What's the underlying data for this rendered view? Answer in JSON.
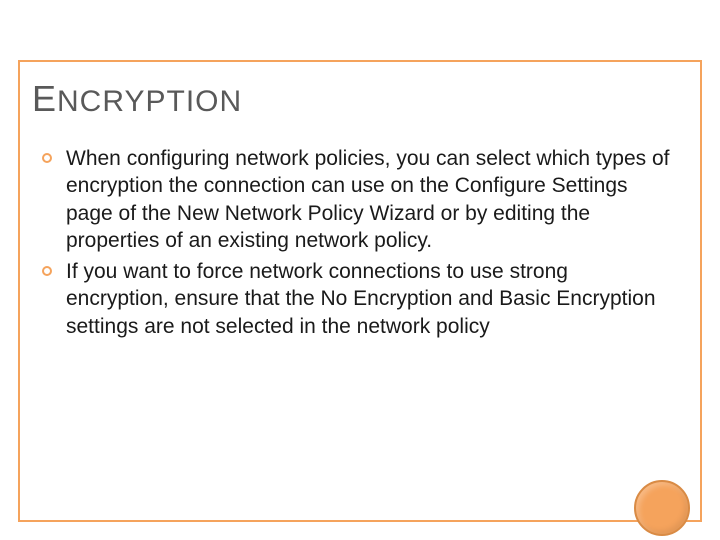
{
  "title": {
    "first_letter": "E",
    "rest": "NCRYPTION"
  },
  "bullets": [
    {
      "text": "When configuring network policies, you can select which types of encryption the connection can use on the Configure Settings page of the New Network Policy Wizard or by editing the properties of an existing network policy."
    },
    {
      "text": "If you want to force network connections to use strong encryption, ensure that the No Encryption and Basic Encryption settings are not selected in the network policy"
    }
  ]
}
